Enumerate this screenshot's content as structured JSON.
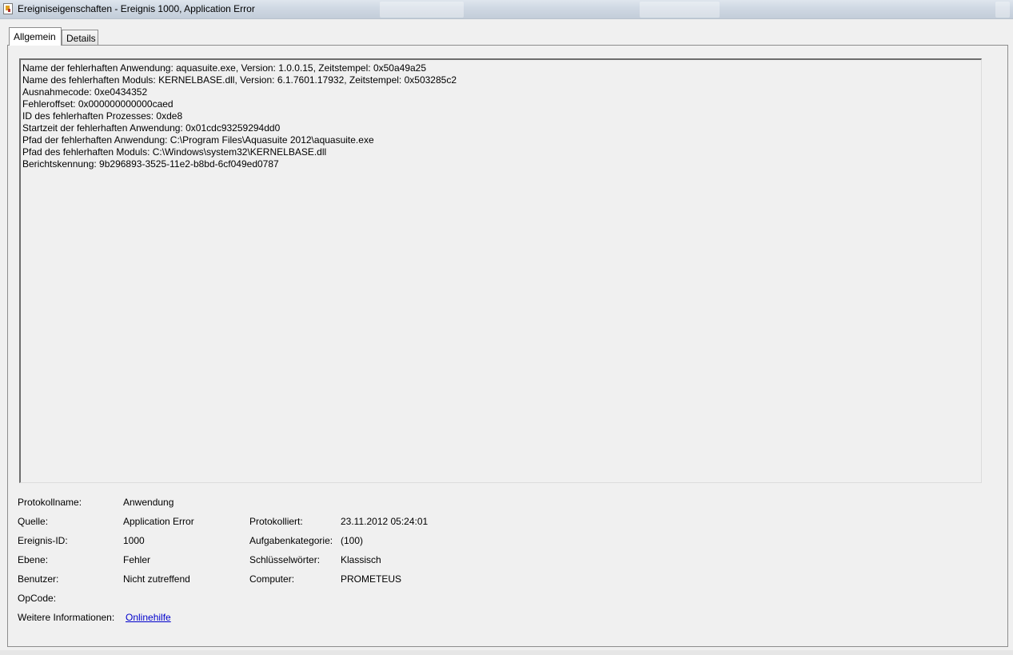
{
  "window": {
    "title": "Ereigniseigenschaften - Ereignis 1000, Application Error"
  },
  "tabs": [
    {
      "label": "Allgemein",
      "active": true
    },
    {
      "label": "Details",
      "active": false
    }
  ],
  "description": {
    "lines": [
      "Name der fehlerhaften Anwendung: aquasuite.exe, Version: 1.0.0.15, Zeitstempel: 0x50a49a25",
      "Name des fehlerhaften Moduls: KERNELBASE.dll, Version: 6.1.7601.17932, Zeitstempel: 0x503285c2",
      "Ausnahmecode: 0xe0434352",
      "Fehleroffset: 0x000000000000caed",
      "ID des fehlerhaften Prozesses: 0xde8",
      "Startzeit der fehlerhaften Anwendung: 0x01cdc93259294dd0",
      "Pfad der fehlerhaften Anwendung: C:\\Program Files\\Aquasuite 2012\\aquasuite.exe",
      "Pfad des fehlerhaften Moduls: C:\\Windows\\system32\\KERNELBASE.dll",
      "Berichtskennung: 9b296893-3525-11e2-b8bd-6cf049ed0787"
    ]
  },
  "fields": {
    "protokollname": {
      "label": "Protokollname:",
      "value": "Anwendung"
    },
    "quelle": {
      "label": "Quelle:",
      "value": "Application Error"
    },
    "protokolliert": {
      "label": "Protokolliert:",
      "value": "23.11.2012 05:24:01"
    },
    "ereignis_id": {
      "label": "Ereignis-ID:",
      "value": "1000"
    },
    "aufgabenkategorie": {
      "label": "Aufgabenkategorie:",
      "value": "(100)"
    },
    "ebene": {
      "label": "Ebene:",
      "value": "Fehler"
    },
    "schluesselwoerter": {
      "label": "Schlüsselwörter:",
      "value": "Klassisch"
    },
    "benutzer": {
      "label": "Benutzer:",
      "value": "Nicht zutreffend"
    },
    "computer": {
      "label": "Computer:",
      "value": "PROMETEUS"
    },
    "opcode": {
      "label": "OpCode:",
      "value": ""
    },
    "weitere_informationen": {
      "label": "Weitere Informationen:",
      "link": "Onlinehilfe"
    }
  },
  "colors": {
    "link": "#0000cc",
    "panel_bg": "#f0f0f0"
  }
}
